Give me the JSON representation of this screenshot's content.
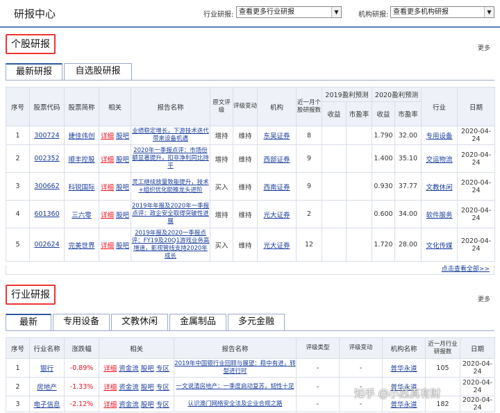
{
  "header": {
    "title": "研报中心",
    "industry_label": "行业研报:",
    "industry_select": "查看更多行业研报",
    "org_label": "机构研报:",
    "org_select": "查看更多机构研报"
  },
  "stock_section": {
    "title": "个股研报",
    "more": "更多",
    "tabs": [
      "最新研报",
      "自选股研报"
    ],
    "headers": {
      "seq": "序号",
      "code": "股票代码",
      "name": "股票简称",
      "related": "相关",
      "report": "报告名称",
      "orig_rating": "原文评级",
      "rating_change": "评级变动",
      "org": "机构",
      "count": "近一月个股研报数",
      "f2019": "2019盈利预测",
      "f2020": "2020盈利预测",
      "income": "收益",
      "pe": "市盈率",
      "industry": "行业",
      "date": "日期"
    },
    "detail_label": "详细",
    "bar_label": "股吧",
    "rows": [
      {
        "seq": "1",
        "code": "300724",
        "name": "捷佳伟创",
        "report": "业绩稳定增长，下游技术迭代带来设备机遇",
        "orig": "增持",
        "change": "维持",
        "org": "东吴证券",
        "count": "8",
        "e19": "",
        "p19": "",
        "e20": "1.790",
        "p20": "32.00",
        "industry": "专用设备",
        "date": "2020-04-24"
      },
      {
        "seq": "2",
        "code": "002352",
        "name": "顺丰控股",
        "report": "2020年一季报点评：市场份额显著提升，扣非净利同比持平",
        "orig": "增持",
        "change": "维持",
        "org": "西部证券",
        "count": "9",
        "e19": "",
        "p19": "",
        "e20": "1.400",
        "p20": "35.10",
        "industry": "交运物流",
        "date": "2020-04-24"
      },
      {
        "seq": "3",
        "code": "300662",
        "name": "科锐国际",
        "report": "灵工继续放量致能提升，技术+组织优化助推龙头进阶",
        "orig": "买入",
        "change": "维持",
        "org": "西南证券",
        "count": "9",
        "e19": "",
        "p19": "",
        "e20": "0.930",
        "p20": "37.77",
        "industry": "文教休闲",
        "date": "2020-04-24"
      },
      {
        "seq": "4",
        "code": "601360",
        "name": "三六零",
        "report": "2019年年报及2020年一季报点评：政企安全取得突破性进展",
        "orig": "增持",
        "change": "维持",
        "org": "光大证券",
        "count": "2",
        "e19": "",
        "p19": "",
        "e20": "0.600",
        "p20": "34.00",
        "industry": "软件服务",
        "date": "2020-04-24"
      },
      {
        "seq": "5",
        "code": "002624",
        "name": "完美世界",
        "report": "2019年报及2020一季报点评：FY19及20Q1游戏业务高增速，影视管线支持2020年成长",
        "orig": "买入",
        "change": "维持",
        "org": "光大证券",
        "count": "12",
        "e19": "",
        "p19": "",
        "e20": "1.720",
        "p20": "28.00",
        "industry": "文化传媒",
        "date": "2020-04-24"
      }
    ],
    "view_all": "点击查看全部>>"
  },
  "industry_section": {
    "title": "行业研报",
    "more": "更多",
    "tabs": [
      "最新",
      "专用设备",
      "文教休闲",
      "金属制品",
      "多元金融"
    ],
    "headers": {
      "seq": "序号",
      "name": "行业名称",
      "change": "涨跌幅",
      "related": "相关",
      "report": "报告名称",
      "rating_type": "评级类型",
      "rating_change": "评级变动",
      "org": "机构名称",
      "count": "近一月行业研报数",
      "date": "日期"
    },
    "related_labels": [
      "详细",
      "资金流",
      "股吧",
      "专区"
    ],
    "rows": [
      {
        "seq": "1",
        "name": "银行",
        "change": "-0.89%",
        "report": "2019年中国银行业回顾与展望：稳中有进，转型进行时",
        "rtype": "-",
        "rchange": "-",
        "org": "普华永道",
        "count": "105",
        "date": "2020-04-24"
      },
      {
        "seq": "2",
        "name": "房地产",
        "change": "-1.33%",
        "report": "一文说清房地产：一季度启动复苏，韧性十足",
        "rtype": "-",
        "rchange": "-",
        "org": "普华永道",
        "count": "",
        "date": "2020-04-24"
      },
      {
        "seq": "3",
        "name": "电子信息",
        "change": "-2.12%",
        "report": "认识澳门网络安全法及企业合规之路",
        "rtype": "-",
        "rchange": "-",
        "org": "普华永道",
        "count": "182",
        "date": "2020-04-24"
      }
    ]
  },
  "watermark": "知乎 @小菜真有财"
}
